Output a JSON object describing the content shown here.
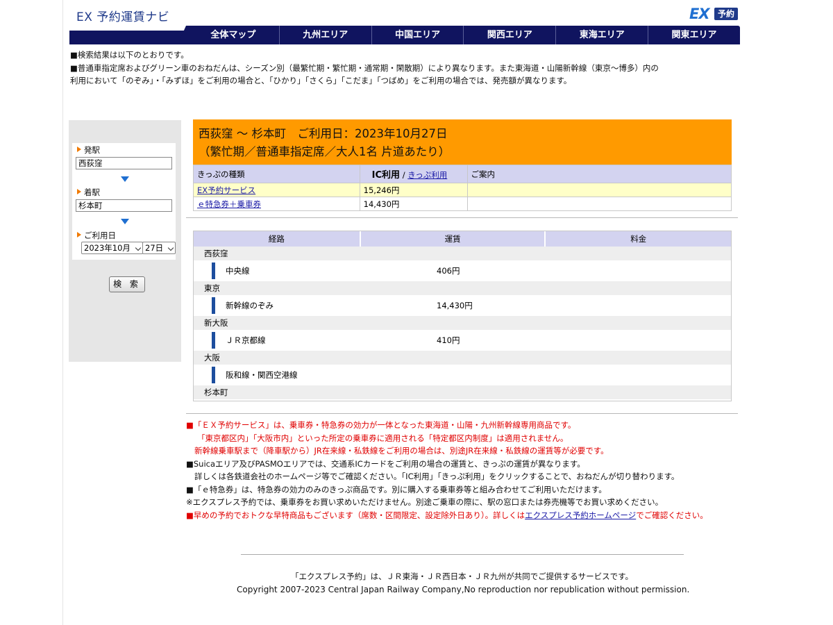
{
  "header": {
    "site_title": "EX 予約運賃ナビ",
    "logo_ex": "EX",
    "logo_yoyaku": "予約"
  },
  "nav": [
    "全体マップ",
    "九州エリア",
    "中国エリア",
    "関西エリア",
    "東海エリア",
    "関東エリア"
  ],
  "intro": {
    "line1": "■検索結果は以下のとおりです。",
    "line2": "■普通車指定席およびグリーン車のおねだんは、シーズン別（最繁忙期・繁忙期・通常期・閑散期）により異なります。また東海道・山陽新幹線（東京～博多）内の",
    "line3": "利用において「のぞみ」・「みずほ」をご利用の場合と、「ひかり」「さくら」「こだま」「つばめ」をご利用の場合では、発売額が異なります。"
  },
  "sidebar": {
    "from_label": "発駅",
    "from_value": "西荻窪",
    "to_label": "着駅",
    "to_value": "杉本町",
    "date_label": "ご利用日",
    "month_value": "2023年10月",
    "day_value": "27日",
    "search_button": "検 索"
  },
  "result": {
    "title_line1": "西荻窪 ～ 杉本町　ご利用日：2023年10月27日",
    "title_line2": "（繁忙期／普通車指定席／大人1名 片道あたり）",
    "col_type": "きっぷの種類",
    "col_ic": "IC利用",
    "col_sep": "/",
    "col_ticket": "きっぷ利用",
    "col_info": "ご案内",
    "rows": [
      {
        "name": "EX予約サービス",
        "price": "15,246円",
        "info": ""
      },
      {
        "name": "ｅ特急券＋乗車券",
        "price": "14,430円",
        "info": ""
      }
    ]
  },
  "route": {
    "headers": [
      "経路",
      "運賃",
      "料金"
    ],
    "stations": [
      "西荻窪",
      "東京",
      "新大阪",
      "大阪",
      "杉本町"
    ],
    "lines": [
      {
        "name": "中央線",
        "fare": "406円"
      },
      {
        "name": "新幹線のぞみ",
        "fare": "14,430円"
      },
      {
        "name": "ＪＲ京都線",
        "fare": "410円"
      },
      {
        "name": "阪和線・関西空港線",
        "fare": ""
      }
    ]
  },
  "notes": {
    "n1": "■「ＥＸ予約サービス」は、乗車券・特急券の効力が一体となった東海道・山陽・九州新幹線専用商品です。",
    "n2": "「東京都区内」「大阪市内」といった所定の乗車券に適用される「特定都区内制度」は適用されません。",
    "n3": "新幹線乗車駅まで（降車駅から）JR在来線・私鉄線をご利用の場合は、別途JR在来線・私鉄線の運賃等が必要です。",
    "n4": "■Suicaエリア及びPASMOエリアでは、交通系ICカードをご利用の場合の運賃と、きっぷの運賃が異なります。",
    "n5": "詳しくは各鉄道会社のホームページ等でご確認ください。「IC利用」「きっぷ利用」をクリックすることで、おねだんが切り替わります。",
    "n6": "■「ｅ特急券」は、特急券の効力のみのきっぷ商品です。別に購入する乗車券等と組み合わせてご利用いただけます。",
    "n7": "※エクスプレス予約では、乗車券をお買い求めいただけません。別途ご乗車の際に、駅の窓口または券売機等でお買い求めください。",
    "n8_pre": "■早めの予約でおトクな早特商品もございます（席数・区間限定、設定除外日あり）。詳しくは",
    "n8_link": "エクスプレス予約ホームページ",
    "n8_post": "でご確認ください。"
  },
  "footer": {
    "line1": "「エクスプレス予約」は、ＪＲ東海・ＪＲ西日本・ＪＲ九州が共同でご提供するサービスです。",
    "line2": "Copyright 2007-2023 Central Japan Railway Company,No reproduction nor republication without permission."
  }
}
